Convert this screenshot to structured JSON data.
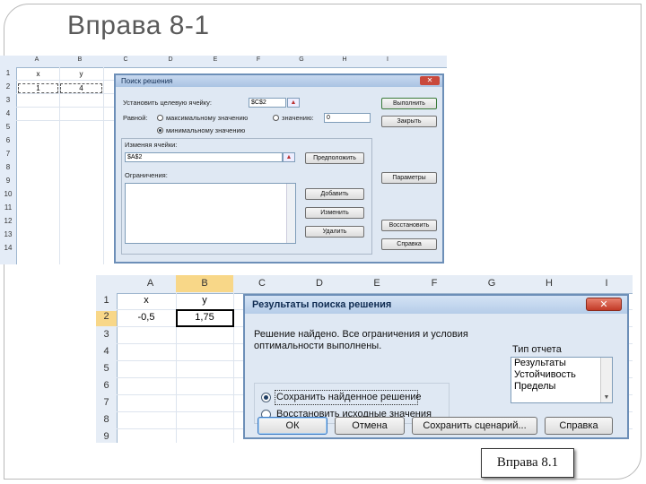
{
  "slide": {
    "title": "Вправа 8-1",
    "caption": "Вправа 8.1"
  },
  "excel_top": {
    "columns": [
      "A",
      "B",
      "C",
      "D",
      "E",
      "F",
      "G",
      "H",
      "I"
    ],
    "rows": [
      "1",
      "2",
      "3",
      "4",
      "5",
      "6",
      "7",
      "8",
      "9",
      "10",
      "11",
      "12",
      "13",
      "14"
    ],
    "cells": {
      "A1": "x",
      "B1": "y",
      "A2": "1",
      "B2": "4"
    }
  },
  "solver_dialog": {
    "title": "Поиск решения",
    "close": "✕",
    "target_label": "Установить целевую ячейку:",
    "target_value": "$C$2",
    "equal_label": "Равной:",
    "opt_max": "максимальному значению",
    "opt_value": "значению:",
    "value_field": "0",
    "opt_min": "минимальному значению",
    "changing_label": "Изменяя ячейки:",
    "changing_value": "$A$2",
    "constraints_label": "Ограничения:",
    "btn_execute": "Выполнить",
    "btn_close": "Закрыть",
    "btn_guess": "Предположить",
    "btn_params": "Параметры",
    "btn_add": "Добавить",
    "btn_change": "Изменить",
    "btn_delete": "Удалить",
    "btn_restore": "Восстановить",
    "btn_help": "Справка"
  },
  "excel_bottom": {
    "columns": [
      "A",
      "B",
      "C",
      "D",
      "E",
      "F",
      "G",
      "H",
      "I"
    ],
    "rows": [
      "1",
      "2",
      "3",
      "4",
      "5",
      "6",
      "7",
      "8",
      "9"
    ],
    "cells": {
      "A1": "x",
      "B1": "y",
      "A2": "-0,5",
      "B2": "1,75"
    }
  },
  "results_dialog": {
    "title": "Результаты поиска решения",
    "close": "✕",
    "message": "Решение найдено. Все ограничения и условия оптимальности выполнены.",
    "report_type_label": "Тип отчета",
    "reports": [
      "Результаты",
      "Устойчивость",
      "Пределы"
    ],
    "opt_keep": "Сохранить найденное решение",
    "opt_restore": "Восстановить исходные значения",
    "btn_ok": "ОК",
    "btn_cancel": "Отмена",
    "btn_save_scenario": "Сохранить сценарий...",
    "btn_help": "Справка"
  }
}
